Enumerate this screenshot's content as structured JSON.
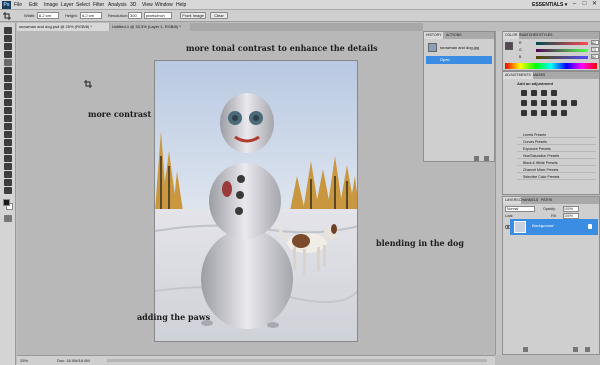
{
  "menubar": {
    "logo": "Ps",
    "items": [
      "File",
      "Edit",
      "Image",
      "Layer",
      "Select",
      "Filter",
      "Analysis",
      "3D",
      "View",
      "Window",
      "Help"
    ],
    "workspace": "ESSENTIALS ▾",
    "window_controls": [
      "–",
      "□",
      "✕"
    ]
  },
  "options_bar": {
    "width_label": "Width:",
    "width_value": "6.2 cm",
    "height_label": "Height:",
    "height_value": "6.2 cm",
    "resolution_label": "Resolution:",
    "resolution_value": "300",
    "resolution_unit": "pixels/inch",
    "front_image_button": "Front Image",
    "clear_button": "Clear"
  },
  "document_tabs": [
    "snowman and dog.psd @ 25% (RGB/8) *",
    "Untitled-1 @ 33.3% (Layer 1, RGB/8) *"
  ],
  "annotations": {
    "top": "more tonal contrast to enhance the details",
    "left": "more contrast",
    "right": "blending in the dog",
    "bottom": "adding the paws"
  },
  "status": {
    "zoom": "25%",
    "doc_info": "Doc: 18.0M/18.0M"
  },
  "history_panel": {
    "tabs": [
      "HISTORY",
      "ACTIONS"
    ],
    "snapshot": "snowman and dog.jpg",
    "step": "Open"
  },
  "color_panel": {
    "tabs": [
      "COLOR",
      "SWATCHES",
      "STYLES"
    ],
    "r": "82",
    "g": "73",
    "b": "82"
  },
  "adjustments_panel": {
    "tabs": [
      "ADJUSTMENTS",
      "MASKS"
    ],
    "heading": "Add an adjustment",
    "presets": [
      "Levels Presets",
      "Curves Presets",
      "Exposure Presets",
      "Hue/Saturation Presets",
      "Black & White Presets",
      "Channel Mixer Presets",
      "Selective Color Presets"
    ]
  },
  "layers_panel": {
    "tabs": [
      "LAYERS",
      "CHANNELS",
      "PATHS"
    ],
    "blend_mode": "Normal",
    "opacity_label": "Opacity:",
    "opacity": "100%",
    "fill_label": "Fill:",
    "fill": "100%",
    "lock_label": "Lock:",
    "layer_name": "Background"
  },
  "colors": {
    "accent": "#3b8de4",
    "panel": "#cfcfcf",
    "canvas": "#b8b8b8"
  }
}
